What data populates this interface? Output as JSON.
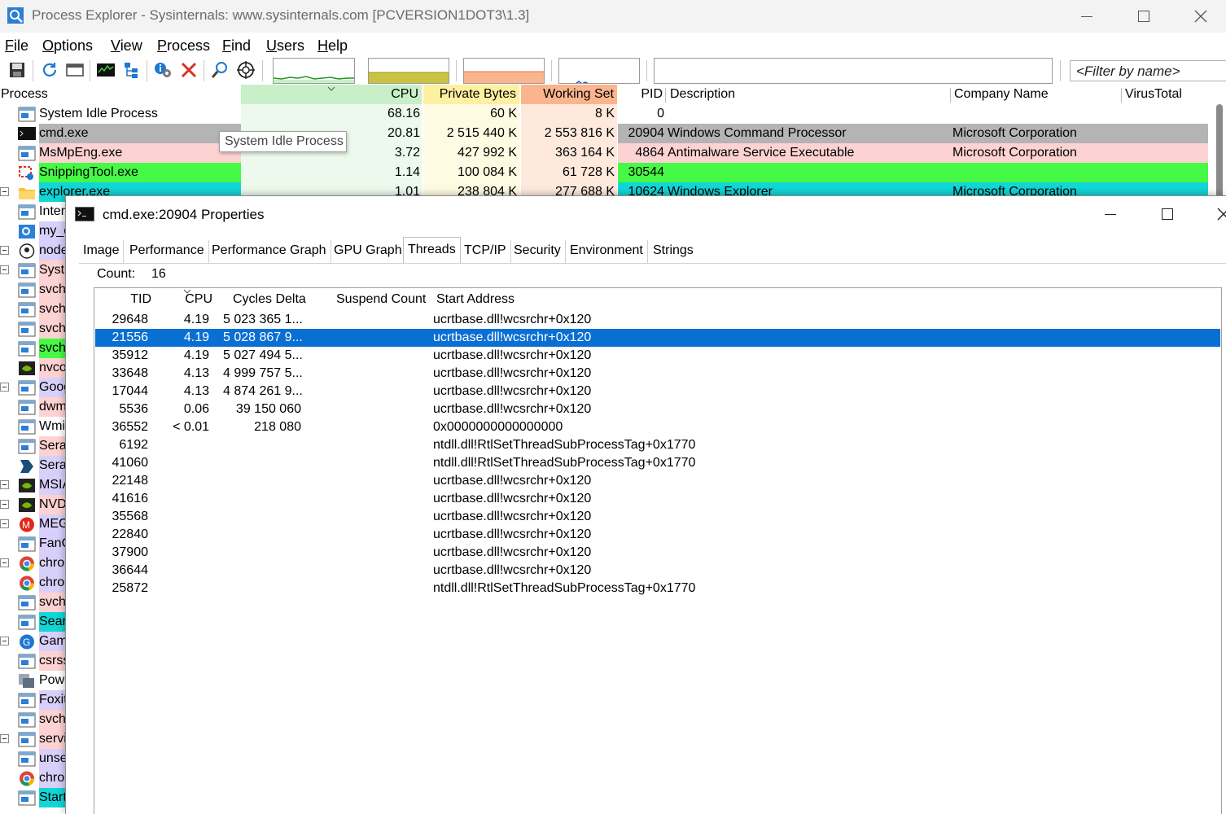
{
  "window": {
    "title": "Process Explorer - Sysinternals: www.sysinternals.com [PCVERSION1DOT3\\1.3]"
  },
  "menu": [
    "File",
    "Options",
    "View",
    "Process",
    "Find",
    "Users",
    "Help"
  ],
  "filter": {
    "placeholder": "<Filter by name>"
  },
  "columns": {
    "process": "Process",
    "cpu": "CPU",
    "private_bytes": "Private Bytes",
    "working_set": "Working Set",
    "pid": "PID",
    "description": "Description",
    "company": "Company Name",
    "virustotal": "VirusTotal"
  },
  "processes": [
    {
      "name": "System Idle Process",
      "cpu": "68.16",
      "private": "60 K",
      "working": "8 K",
      "pid": "0",
      "description": "",
      "company": "",
      "color": "#ffffff"
    },
    {
      "name": "cmd.exe",
      "cpu": "20.81",
      "private": "2 515 440 K",
      "working": "2 553 816 K",
      "pid": "20904",
      "description": "Windows Command Processor",
      "company": "Microsoft Corporation",
      "color": "#b4b4b4"
    },
    {
      "name": "MsMpEng.exe",
      "cpu": "3.72",
      "private": "427 992 K",
      "working": "363 164 K",
      "pid": "4864",
      "description": "Antimalware Service Executable",
      "company": "Microsoft Corporation",
      "color": "#fdd2d2"
    },
    {
      "name": "SnippingTool.exe",
      "cpu": "1.14",
      "private": "100 084 K",
      "working": "61 728 K",
      "pid": "30544",
      "description": "",
      "company": "",
      "color": "#46f946"
    },
    {
      "name": "explorer.exe",
      "cpu": "1.01",
      "private": "238 804 K",
      "working": "277 688 K",
      "pid": "10624",
      "description": "Windows Explorer",
      "company": "Microsoft Corporation",
      "color": "#11d6d6"
    }
  ],
  "process_partial": [
    {
      "name": "Inter",
      "color": "#fff"
    },
    {
      "name": "my_c",
      "color": "#d8d0fa"
    },
    {
      "name": "node",
      "color": "#d8d0fa"
    },
    {
      "name": "Syste",
      "color": "#fdd2d2"
    },
    {
      "name": "svch",
      "color": "#fdd2d2"
    },
    {
      "name": "svch",
      "color": "#fdd2d2"
    },
    {
      "name": "svch",
      "color": "#fdd2d2"
    },
    {
      "name": "svch",
      "color": "#46f946"
    },
    {
      "name": "nvco",
      "color": "#fdd2d2"
    },
    {
      "name": "Goog",
      "color": "#d8d0fa"
    },
    {
      "name": "dwm",
      "color": "#fdd2d2"
    },
    {
      "name": "Wmi",
      "color": "#fff"
    },
    {
      "name": "Sera",
      "color": "#fdd2d2"
    },
    {
      "name": "Sera",
      "color": "#d8d0fa"
    },
    {
      "name": "MSIA",
      "color": "#d8d0fa"
    },
    {
      "name": "NVD",
      "color": "#fdd2d2"
    },
    {
      "name": "MEG",
      "color": "#d8d0fa"
    },
    {
      "name": "FanC",
      "color": "#d8d0fa"
    },
    {
      "name": "chro",
      "color": "#d8d0fa"
    },
    {
      "name": "chro",
      "color": "#d8d0fa"
    },
    {
      "name": "svch",
      "color": "#fdd2d2"
    },
    {
      "name": "Sear",
      "color": "#11d6d6"
    },
    {
      "name": "Gam",
      "color": "#d8d0fa"
    },
    {
      "name": "csrss",
      "color": "#fdd2d2"
    },
    {
      "name": "Powe",
      "color": "#fff"
    },
    {
      "name": "Foxit",
      "color": "#d8d0fa"
    },
    {
      "name": "svch",
      "color": "#fdd2d2"
    },
    {
      "name": "servi",
      "color": "#fdd2d2"
    },
    {
      "name": "unse",
      "color": "#d8d0fa"
    },
    {
      "name": "chro",
      "color": "#d8d0fa"
    },
    {
      "name": "Start",
      "color": "#11d6d6"
    }
  ],
  "tooltip": "System Idle Process",
  "dialog": {
    "title": "cmd.exe:20904 Properties",
    "tabs": [
      "Image",
      "Performance",
      "Performance Graph",
      "GPU Graph",
      "Threads",
      "TCP/IP",
      "Security",
      "Environment",
      "Strings"
    ],
    "active_tab": "Threads",
    "count_label": "Count:",
    "count_value": "16",
    "thread_columns": {
      "tid": "TID",
      "cpu": "CPU",
      "cycles": "Cycles Delta",
      "suspend": "Suspend Count",
      "start": "Start Address"
    },
    "threads": [
      {
        "tid": "29648",
        "cpu": "4.19",
        "cycles": "5 023 365 1...",
        "start": "ucrtbase.dll!wcsrchr+0x120"
      },
      {
        "tid": "21556",
        "cpu": "4.19",
        "cycles": "5 028 867 9...",
        "start": "ucrtbase.dll!wcsrchr+0x120",
        "selected": true
      },
      {
        "tid": "35912",
        "cpu": "4.19",
        "cycles": "5 027 494 5...",
        "start": "ucrtbase.dll!wcsrchr+0x120"
      },
      {
        "tid": "33648",
        "cpu": "4.13",
        "cycles": "4 999 757 5...",
        "start": "ucrtbase.dll!wcsrchr+0x120"
      },
      {
        "tid": "17044",
        "cpu": "4.13",
        "cycles": "4 874 261 9...",
        "start": "ucrtbase.dll!wcsrchr+0x120"
      },
      {
        "tid": "5536",
        "cpu": "0.06",
        "cycles": "39 150 060",
        "start": "ucrtbase.dll!wcsrchr+0x120"
      },
      {
        "tid": "36552",
        "cpu": "< 0.01",
        "cycles": "218 080",
        "start": "0x0000000000000000"
      },
      {
        "tid": "6192",
        "cpu": "",
        "cycles": "",
        "start": "ntdll.dll!RtlSetThreadSubProcessTag+0x1770"
      },
      {
        "tid": "41060",
        "cpu": "",
        "cycles": "",
        "start": "ntdll.dll!RtlSetThreadSubProcessTag+0x1770"
      },
      {
        "tid": "22148",
        "cpu": "",
        "cycles": "",
        "start": "ucrtbase.dll!wcsrchr+0x120"
      },
      {
        "tid": "41616",
        "cpu": "",
        "cycles": "",
        "start": "ucrtbase.dll!wcsrchr+0x120"
      },
      {
        "tid": "35568",
        "cpu": "",
        "cycles": "",
        "start": "ucrtbase.dll!wcsrchr+0x120"
      },
      {
        "tid": "22840",
        "cpu": "",
        "cycles": "",
        "start": "ucrtbase.dll!wcsrchr+0x120"
      },
      {
        "tid": "37900",
        "cpu": "",
        "cycles": "",
        "start": "ucrtbase.dll!wcsrchr+0x120"
      },
      {
        "tid": "36644",
        "cpu": "",
        "cycles": "",
        "start": "ucrtbase.dll!wcsrchr+0x120"
      },
      {
        "tid": "25872",
        "cpu": "",
        "cycles": "",
        "start": "ntdll.dll!RtlSetThreadSubProcessTag+0x1770"
      }
    ]
  },
  "colors": {
    "cpu_header": "#c9efc9",
    "private_header": "#fdf0a0",
    "working_header": "#fbb58e",
    "selection": "#0a6fd3"
  }
}
